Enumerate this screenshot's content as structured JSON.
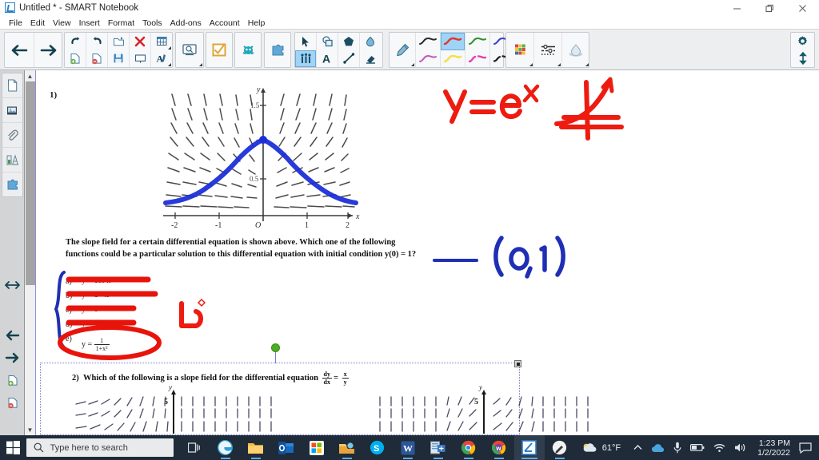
{
  "window": {
    "title": "Untitled * - SMART Notebook",
    "app_icon": "smart-notebook-icon",
    "controls": {
      "minimize": "minimize-icon",
      "restore": "restore-icon",
      "close": "close-icon"
    }
  },
  "menu": {
    "items": [
      "File",
      "Edit",
      "View",
      "Insert",
      "Format",
      "Tools",
      "Add-ons",
      "Account",
      "Help"
    ]
  },
  "toolbar": {
    "groups": [
      {
        "name": "navigation",
        "buttons": [
          {
            "name": "previous-page-button",
            "icon": "arrow-left-icon"
          },
          {
            "name": "next-page-button",
            "icon": "arrow-right-icon"
          }
        ]
      },
      {
        "name": "page-edit",
        "buttons": [
          {
            "name": "undo-button",
            "icon": "undo-icon"
          },
          {
            "name": "add-page-button",
            "icon": "page-add-icon"
          },
          {
            "name": "redo-button",
            "icon": "redo-icon"
          },
          {
            "name": "delete-page-button",
            "icon": "page-delete-icon"
          },
          {
            "name": "open-file-button",
            "icon": "folder-open-icon"
          },
          {
            "name": "save-button",
            "icon": "save-disk-icon"
          },
          {
            "name": "delete-button",
            "icon": "red-x-icon"
          },
          {
            "name": "screen-shade-button",
            "icon": "screen-shade-icon"
          },
          {
            "name": "table-button",
            "icon": "table-grid-icon"
          },
          {
            "name": "text-style-button",
            "icon": "text-A-icon"
          }
        ]
      },
      {
        "name": "capture",
        "buttons": [
          {
            "name": "screen-capture-button",
            "icon": "screen-capture-icon"
          }
        ]
      },
      {
        "name": "response",
        "buttons": [
          {
            "name": "smart-response-button",
            "icon": "checkbox-orange-icon"
          }
        ]
      },
      {
        "name": "lab",
        "buttons": [
          {
            "name": "lab-activity-button",
            "icon": "teal-creature-icon"
          }
        ]
      },
      {
        "name": "addon",
        "buttons": [
          {
            "name": "add-ons-button",
            "icon": "blue-puzzle-icon"
          }
        ]
      },
      {
        "name": "tools",
        "buttons": [
          {
            "name": "select-tool-button",
            "icon": "cursor-arrow-icon"
          },
          {
            "name": "shape-recognition-button",
            "icon": "shapes-icon"
          },
          {
            "name": "shapes-button",
            "icon": "pentagon-icon"
          },
          {
            "name": "fill-button",
            "icon": "paint-bucket-icon"
          },
          {
            "name": "creative-pen-button",
            "icon": "people-icon",
            "selected": true
          },
          {
            "name": "text-button",
            "icon": "text-A-icon"
          },
          {
            "name": "line-button",
            "icon": "line-icon"
          },
          {
            "name": "eraser-button",
            "icon": "eraser-icon"
          }
        ]
      },
      {
        "name": "pens",
        "buttons": [
          {
            "name": "pen-tool-button",
            "icon": "pen-icon"
          },
          {
            "name": "pen-style-black-thin",
            "icon": "stroke-icon",
            "color": "#2a2a2a"
          },
          {
            "name": "pen-style-purple",
            "icon": "stroke-icon",
            "color": "#b455b4"
          },
          {
            "name": "pen-style-red",
            "icon": "stroke-icon",
            "color": "#e0392e",
            "selected": true
          },
          {
            "name": "pen-style-yellow",
            "icon": "stroke-icon",
            "color": "#f2e14c"
          },
          {
            "name": "pen-style-green",
            "icon": "stroke-icon",
            "color": "#2c8f2c"
          },
          {
            "name": "pen-style-magenta",
            "icon": "stroke-icon",
            "color": "#e63fb0"
          },
          {
            "name": "pen-style-blue",
            "icon": "stroke-icon",
            "color": "#3b3bc8"
          },
          {
            "name": "pen-style-dashed",
            "icon": "stroke-icon",
            "color": "#1a1a1a"
          }
        ]
      },
      {
        "name": "properties",
        "buttons": [
          {
            "name": "color-palette-button",
            "icon": "color-grid-icon"
          },
          {
            "name": "line-properties-button",
            "icon": "line-properties-icon"
          },
          {
            "name": "transparency-button",
            "icon": "transparency-icon"
          }
        ]
      }
    ],
    "settings": {
      "name": "settings-button",
      "icon": "gear-icon"
    },
    "move_toolbar": {
      "name": "move-toolbar-button",
      "icon": "up-down-arrow-icon"
    }
  },
  "sidebar": {
    "top_items": [
      {
        "name": "page-sorter-tab",
        "icon": "page-icon"
      },
      {
        "name": "gallery-tab",
        "icon": "image-icon"
      },
      {
        "name": "attachments-tab",
        "icon": "paperclip-icon"
      },
      {
        "name": "properties-tab",
        "icon": "properties-icon"
      },
      {
        "name": "add-ons-tab",
        "icon": "blue-puzzle-icon"
      }
    ],
    "resize_handle": {
      "name": "sidebar-resize-handle",
      "icon": "left-right-arrow-icon"
    },
    "bottom_items": [
      {
        "name": "back-button",
        "icon": "arrow-left-icon"
      },
      {
        "name": "forward-button",
        "icon": "arrow-right-icon"
      },
      {
        "name": "add-page-button",
        "icon": "page-add-icon"
      },
      {
        "name": "delete-page-button",
        "icon": "page-delete-icon"
      }
    ]
  },
  "canvas": {
    "scrollbar": {
      "name": "canvas-vertical-scrollbar",
      "up": "chevron-up-icon",
      "down": "chevron-down-icon"
    },
    "question1": {
      "number": "1)",
      "text_line1": "The slope field for a certain differential equation is shown above. Which one of the following",
      "text_line2": "functions could be a particular solution to this differential equation with initial condition y(0) = 1?",
      "choices": [
        {
          "label": "a)",
          "expr": "y = cos x",
          "struck": true
        },
        {
          "label": "b)",
          "expr": "y = 1 - x²",
          "struck": true
        },
        {
          "label": "c)",
          "expr": "y = e⁻ˣ",
          "struck": true
        },
        {
          "label": "d)",
          "expr": "y = √(1 - x²)",
          "struck": true
        },
        {
          "label": "e)",
          "num": "1",
          "den": "1+x²",
          "prefix": "y =",
          "circled": true
        }
      ]
    },
    "question2": {
      "number": "2)",
      "text": "Which of the following is a slope field for the differential equation",
      "equation_num": "dy",
      "equation_den": "dx",
      "equation_rnum": "x",
      "equation_rden": "y",
      "selected": true
    },
    "annotations": [
      {
        "name": "ink-y-equals-ex",
        "text": "y=eˣ",
        "color": "#ee1b10"
      },
      {
        "name": "ink-crossed-graph",
        "text": "",
        "color": "#ee1b10"
      },
      {
        "name": "ink-point-0-1",
        "text": "(0,1)",
        "color": "#1f2fb5"
      },
      {
        "name": "ink-red-L-mark",
        "text": "",
        "color": "#ee1b10"
      },
      {
        "name": "ink-blue-solution-curve",
        "text": "",
        "color": "#1b2fd8"
      },
      {
        "name": "ink-blue-brace",
        "text": "",
        "color": "#1f2fb5"
      },
      {
        "name": "ink-blue-underline",
        "text": "",
        "color": "#1f2fb5"
      },
      {
        "name": "ink-red-circle",
        "text": "",
        "color": "#ee1b10"
      }
    ],
    "figure1": {
      "x_ticks": [
        "-2",
        "-1",
        "O",
        "1",
        "2"
      ],
      "y_ticks": [
        "1.5",
        "1",
        "0.5"
      ],
      "x_axis_label": "x",
      "y_axis_label": "y"
    },
    "figure2": {
      "y_axis_label": "y",
      "y_tick": "5"
    }
  },
  "taskbar": {
    "start": {
      "name": "start-button",
      "icon": "windows-logo-icon"
    },
    "search": {
      "name": "search-input",
      "placeholder": "Type here to search",
      "icon": "search-icon"
    },
    "task_view": {
      "name": "task-view-button",
      "icon": "task-view-icon"
    },
    "apps": [
      {
        "name": "taskbar-edge",
        "icon": "edge-icon",
        "color": "#2c9fd6"
      },
      {
        "name": "taskbar-file-explorer",
        "icon": "folder-icon",
        "color": "#f5bb41"
      },
      {
        "name": "taskbar-outlook",
        "icon": "outlook-icon",
        "color": "#1669bd"
      },
      {
        "name": "taskbar-store",
        "icon": "store-icon",
        "color": "#ffffff"
      },
      {
        "name": "taskbar-onedrive",
        "icon": "onedrive-icon",
        "color": "#e8a33d"
      },
      {
        "name": "taskbar-skype",
        "icon": "skype-icon",
        "color": "#00aff0"
      },
      {
        "name": "taskbar-word",
        "icon": "word-icon",
        "color": "#2b579a"
      },
      {
        "name": "taskbar-app-blue",
        "icon": "app-icon",
        "color": "#5b9bd5"
      },
      {
        "name": "taskbar-chrome-1",
        "icon": "chrome-icon",
        "color": "#e8453c"
      },
      {
        "name": "taskbar-chrome-2",
        "icon": "chrome-icon",
        "color": "#7b3fa0"
      },
      {
        "name": "taskbar-smart-notebook",
        "icon": "smart-notebook-icon",
        "color": "#2a7fc9"
      },
      {
        "name": "taskbar-smart-ink",
        "icon": "smart-ink-icon",
        "color": "#3a3a3a"
      }
    ],
    "weather": {
      "name": "weather-widget",
      "temperature": "61°F",
      "icon": "cloud-icon"
    },
    "tray": [
      {
        "name": "show-hidden-icons-button",
        "icon": "chevron-up-icon"
      },
      {
        "name": "onedrive-tray-icon",
        "icon": "cloud-icon"
      },
      {
        "name": "microphone-tray-icon",
        "icon": "microphone-icon"
      },
      {
        "name": "battery-tray-icon",
        "icon": "battery-icon"
      },
      {
        "name": "network-tray-icon",
        "icon": "wifi-icon"
      },
      {
        "name": "volume-tray-icon",
        "icon": "speaker-icon"
      }
    ],
    "clock": {
      "name": "taskbar-clock",
      "time": "1:23 PM",
      "date": "1/2/2022"
    },
    "notifications": {
      "name": "notifications-button",
      "icon": "speech-bubble-icon"
    }
  }
}
